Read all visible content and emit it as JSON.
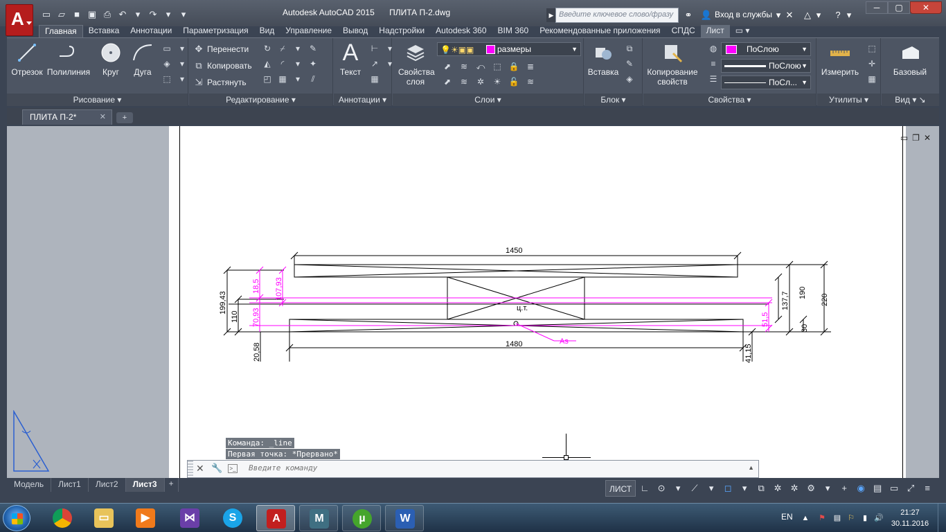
{
  "window": {
    "app_title": "Autodesk AutoCAD 2015",
    "file_title": "ПЛИТА П-2.dwg",
    "search_placeholder": "Введите ключевое слово/фразу",
    "login_label": "Вход в службы"
  },
  "ribbon_tabs": [
    "Главная",
    "Вставка",
    "Аннотации",
    "Параметризация",
    "Вид",
    "Управление",
    "Вывод",
    "Надстройки",
    "Autodesk 360",
    "BIM 360",
    "Рекомендованные приложения",
    "СПДС",
    "Лист"
  ],
  "ribbon": {
    "draw": {
      "title": "Рисование",
      "line": "Отрезок",
      "polyline": "Полилиния",
      "circle": "Круг",
      "arc": "Дуга"
    },
    "modify": {
      "title": "Редактирование",
      "move": "Перенести",
      "copy": "Копировать",
      "stretch": "Растянуть"
    },
    "annotation": {
      "title": "Аннотации",
      "text": "Текст"
    },
    "layers": {
      "title": "Слои",
      "properties": "Свойства слоя",
      "current_layer": "размеры",
      "layer_color": "#ff00ff"
    },
    "block": {
      "title": "Блок",
      "insert": "Вставка"
    },
    "properties": {
      "title": "Свойства",
      "match": "Копирование свойств",
      "color": "ПоСлою",
      "lineweight": "ПоСлою",
      "linetype": "ПоСл..."
    },
    "utilities": {
      "title": "Утилиты",
      "measure": "Измерить"
    },
    "view": {
      "title": "Вид",
      "base": "Базовый"
    }
  },
  "document_tab": "ПЛИТА П-2*",
  "drawing": {
    "dim_top": "1450",
    "dim_bottom": "1480",
    "dim_left_1": "199,43",
    "dim_left_2": "110",
    "dim_left_3": "20,58",
    "dim_mag_1": "18,5",
    "dim_mag_2": "107,93",
    "dim_mag_3": "70,93",
    "dim_mag_right": "51,5",
    "dim_right_1": "137,7",
    "dim_right_2": "190",
    "dim_right_3": "220",
    "dim_right_4": "30",
    "dim_right_5": "41,15",
    "label_center": "ц.т.",
    "label_as": "As",
    "dim_color": "#000000",
    "accent_color": "#ff00ff"
  },
  "command": {
    "history_1": "Команда:  _line",
    "history_2": "Первая точка: *Прервано*",
    "placeholder": "Введите команду"
  },
  "layout_tabs": [
    "Модель",
    "Лист1",
    "Лист2",
    "Лист3"
  ],
  "active_layout": "Лист3",
  "status": {
    "space_label": "ЛИСТ"
  },
  "taskbar": {
    "lang": "EN",
    "time": "21:27",
    "date": "30.11.2016"
  }
}
